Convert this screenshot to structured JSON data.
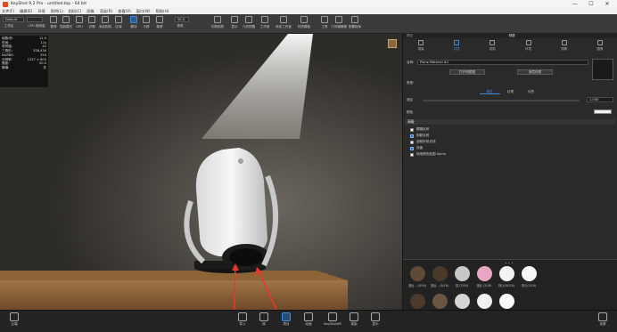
{
  "window": {
    "title": "KeyShot 9.2 Pro - untitled.bip - 64 bit",
    "minimize": "—",
    "maximize": "☐",
    "close": "✕"
  },
  "menu": [
    "文件(F)",
    "编辑(E)",
    "环境",
    "照明(L)",
    "相机(C)",
    "图像",
    "渲染(R)",
    "查看(V)",
    "窗口(W)",
    "帮助(H)"
  ],
  "toolbar": {
    "workspace_select": "Default",
    "cpu_select": "",
    "zoom_value": "50.0",
    "items": [
      "工作区",
      "CPU 使用量",
      "暂停",
      "性能模式",
      "GPU",
      "去噪",
      "添加相机",
      "区域",
      "翻译",
      "平移",
      "推移",
      "视角",
      "切换相机",
      "显示",
      "几何视图",
      "工作室",
      "添加工作室",
      "材质模板",
      "工具",
      "几何编辑器",
      "配置程序"
    ]
  },
  "hud": {
    "rows": [
      [
        "帧数/秒:",
        "12.0"
      ],
      [
        "时间:",
        "11s"
      ],
      [
        "采样值:",
        "42"
      ],
      [
        "三角形:",
        "338,436"
      ],
      [
        "NURBS:",
        "254"
      ],
      [
        "分辨率:",
        "1257 × 805"
      ],
      [
        "焦距:",
        "50.0"
      ],
      [
        "降噪:",
        "关"
      ]
    ]
  },
  "panel": {
    "tabs": [
      "项目",
      "材质"
    ],
    "active_tab": "材质",
    "icons": [
      "场景",
      "材质",
      "相机",
      "环境",
      "照明",
      "图像"
    ],
    "active_icon": "材质",
    "name_label": "名称:",
    "name_value": "Plane Material #2",
    "graph_button": "打开材质图",
    "multi_button": "多层材质",
    "type_label": "类型:",
    "type_value": "",
    "subtabs": [
      "属性",
      "纹理",
      "标签"
    ],
    "active_subtab": "属性",
    "roughness_label": "漫反",
    "roughness_value": "1.000",
    "color_label": "颜色",
    "section_title": "高级",
    "checkboxes": [
      {
        "label": "模糊反射",
        "checked": false
      },
      {
        "label": "阴影反射",
        "checked": true
      },
      {
        "label": "漫射折射光线",
        "checked": false
      },
      {
        "label": "双面",
        "checked": true
      },
      {
        "label": "使用颜色贴图 Alpha",
        "checked": false
      }
    ],
    "library_dots": "• • •",
    "library": [
      {
        "label": "漫反... (8/16)",
        "color": "#5e4a36"
      },
      {
        "label": "漫反... (8/16)",
        "color": "#4a3a2c"
      },
      {
        "label": "铝 (3/16)",
        "color": "#c8c8c8"
      },
      {
        "label": "漫反 (3/16)",
        "color": "#e8a6c4"
      },
      {
        "label": "默认(64/16)",
        "color": "#f4f4f4"
      },
      {
        "label": "默认(3/16)",
        "color": "#f6f6f6"
      }
    ]
  },
  "bottombar": {
    "left": "云端",
    "items": [
      "导入",
      "库",
      "项目",
      "动画",
      "KeyShotXR",
      "渲染",
      "显示"
    ],
    "active": "项目",
    "right": "全屏"
  }
}
